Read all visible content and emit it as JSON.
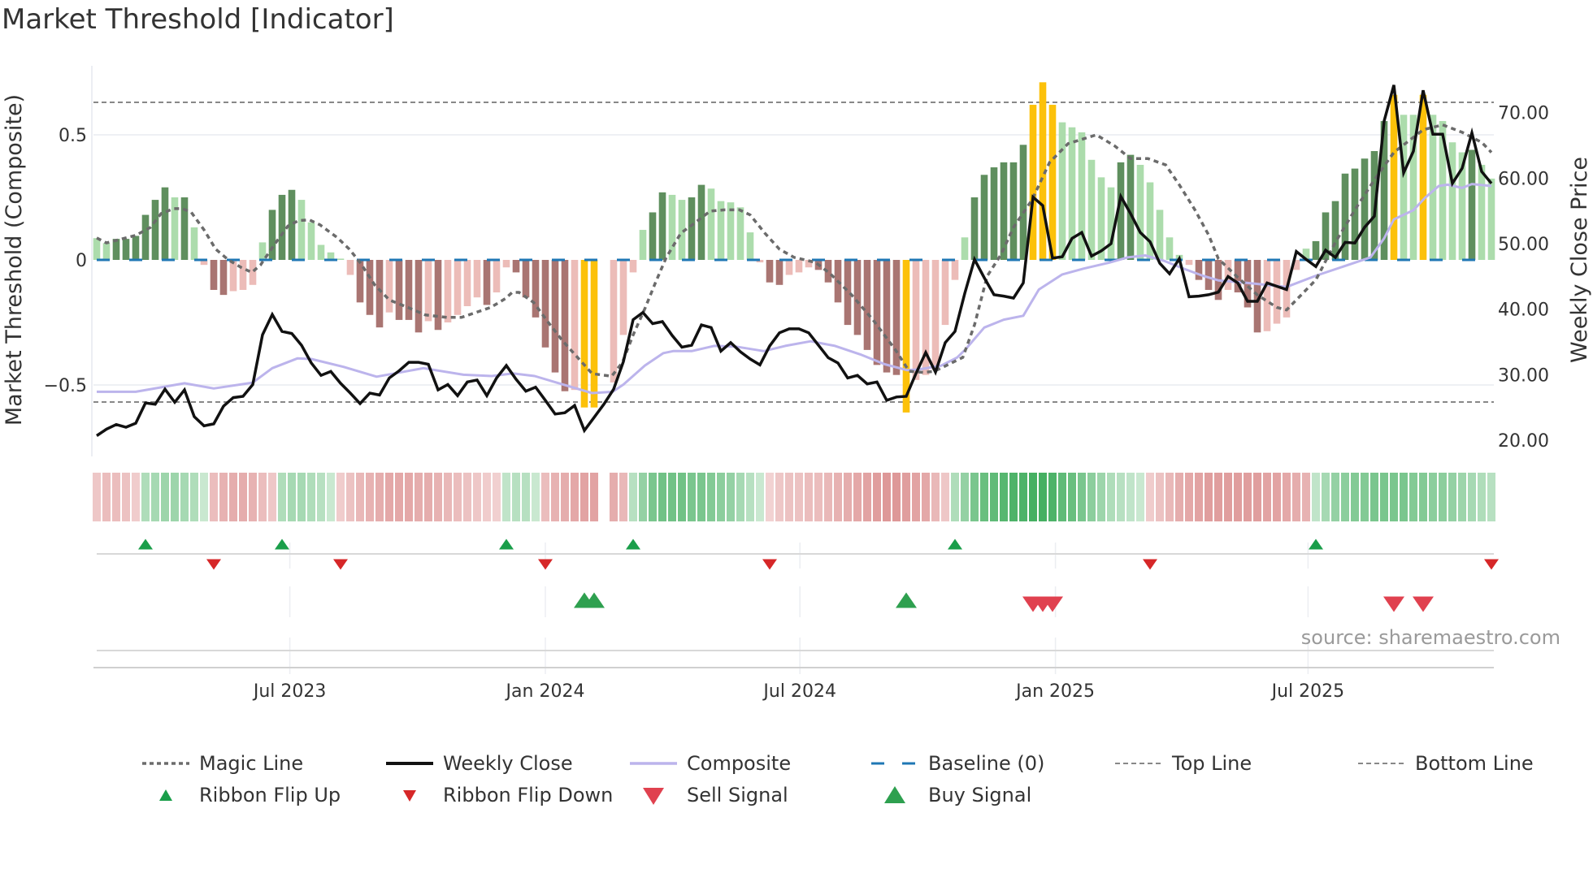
{
  "title": "Market Threshold [Indicator]",
  "source": "source: sharemaestro.com",
  "colors": {
    "hist_dark_green": "#5f8f5e",
    "hist_light_green": "#acdcac",
    "hist_dark_red": "#a97572",
    "hist_light_red": "#ecbcb8",
    "hist_extreme": "#fcc10a",
    "magic": "#6b6b6b",
    "price": "#111111",
    "composite": "#bcb4ec",
    "baseline": "#1f77b4",
    "threshold_lines": "#888888",
    "flip_up": "#1a9e4a",
    "flip_down": "#d62728",
    "sell": "#e0414f",
    "buy": "#2ea04f"
  },
  "chart_data": {
    "type": "bar+line",
    "title": "Market Threshold [Indicator]",
    "x_unit": "week index (weekly bars, ~Feb 2023 to Nov 2025)",
    "xticks": [
      {
        "week": 19.8,
        "label": "Jul 2023"
      },
      {
        "week": 46,
        "label": "Jan 2024"
      },
      {
        "week": 72.1,
        "label": "Jul 2024"
      },
      {
        "week": 98.3,
        "label": "Jan 2025"
      },
      {
        "week": 124.2,
        "label": "Jul 2025"
      }
    ],
    "left_axis": {
      "label": "Market Threshold (Composite)",
      "range": [
        -0.8,
        0.78
      ],
      "ticks": [
        {
          "v": 0.5,
          "label": "0.5"
        },
        {
          "v": 0,
          "label": "0"
        },
        {
          "v": -0.5,
          "label": "−0.5"
        }
      ]
    },
    "right_axis": {
      "label": "Weekly Close Price",
      "range": [
        17,
        77
      ],
      "ticks": [
        {
          "v": 70,
          "label": "70.00"
        },
        {
          "v": 60,
          "label": "60.00"
        },
        {
          "v": 50,
          "label": "50.00"
        },
        {
          "v": 40,
          "label": "40.00"
        },
        {
          "v": 30,
          "label": "30.00"
        },
        {
          "v": 20,
          "label": "20.00"
        }
      ]
    },
    "top_line": 0.63,
    "bottom_line": -0.568,
    "baseline": 0,
    "histogram": {
      "types": "LLDDDDDDLDLLDDLLLLDDDLLLLLLDDDLDDDLDLLLLDLLDDDDDDLYYNLLLLDDLLDDLLLLLLDDLLLDDDDDDDDDYLLLLLLDDDDDDYYYLLLLLLDDLLLLLLDDDLDDDLLLLLDDDDDDDDYLLYLLLLDLL",
      "values": [
        0.087,
        0.067,
        0.084,
        0.084,
        0.096,
        0.18,
        0.24,
        0.29,
        0.25,
        0.25,
        0.13,
        -0.02,
        -0.12,
        -0.14,
        -0.125,
        -0.12,
        -0.1,
        0.07,
        0.2,
        0.26,
        0.28,
        0.24,
        0.15,
        0.06,
        0.03,
        0.005,
        -0.06,
        -0.17,
        -0.22,
        -0.27,
        -0.21,
        -0.24,
        -0.24,
        -0.29,
        -0.245,
        -0.28,
        -0.25,
        -0.22,
        -0.185,
        -0.15,
        -0.18,
        -0.13,
        -0.03,
        -0.05,
        -0.15,
        -0.23,
        -0.35,
        -0.45,
        -0.525,
        -0.52,
        -0.59,
        -0.59,
        0,
        -0.49,
        -0.3,
        -0.05,
        0.12,
        0.19,
        0.27,
        0.26,
        0.24,
        0.25,
        0.3,
        0.285,
        0.235,
        0.23,
        0.21,
        0.11,
        -0.01,
        -0.09,
        -0.1,
        -0.06,
        -0.05,
        -0.03,
        -0.04,
        -0.09,
        -0.17,
        -0.26,
        -0.3,
        -0.36,
        -0.42,
        -0.45,
        -0.46,
        -0.61,
        -0.48,
        -0.46,
        -0.44,
        -0.26,
        -0.08,
        0.09,
        0.25,
        0.34,
        0.37,
        0.39,
        0.39,
        0.46,
        0.62,
        0.71,
        0.62,
        0.55,
        0.53,
        0.51,
        0.4,
        0.33,
        0.29,
        0.39,
        0.42,
        0.38,
        0.31,
        0.2,
        0.09,
        0.02,
        -0.02,
        -0.08,
        -0.12,
        -0.16,
        -0.12,
        -0.13,
        -0.19,
        -0.29,
        -0.285,
        -0.255,
        -0.23,
        -0.04,
        0.045,
        0.075,
        0.19,
        0.235,
        0.345,
        0.365,
        0.405,
        0.435,
        0.555,
        0.66,
        0.58,
        0.58,
        0.66,
        0.58,
        0.555,
        0.47,
        0.43,
        0.44,
        0.38,
        0.325
      ]
    },
    "weekly_close": [
      20.7,
      21.7,
      22.4,
      22,
      22.6,
      25.7,
      25.5,
      27.8,
      25.8,
      27.7,
      23.6,
      22.2,
      22.5,
      25.2,
      26.5,
      26.7,
      28.5,
      36.1,
      39.2,
      36.6,
      36.3,
      34.5,
      31.8,
      29.9,
      30.5,
      28.7,
      27.2,
      25.6,
      27.2,
      26.9,
      29.5,
      30.6,
      31.9,
      31.9,
      31.6,
      27.7,
      28.5,
      26.8,
      28.9,
      29.2,
      26.8,
      29.5,
      31.4,
      29.3,
      27.5,
      28.1,
      26.1,
      24,
      24.2,
      25.3,
      21.5,
      23.5,
      25.5,
      27.8,
      32,
      38.4,
      39.5,
      37.8,
      38.1,
      36,
      34.2,
      34.5,
      37.6,
      37.2,
      33.6,
      34.9,
      33.5,
      32.4,
      31.5,
      34.4,
      36.4,
      37,
      37,
      36.4,
      34.5,
      32.6,
      31.8,
      29.5,
      29.9,
      28.6,
      28.9,
      26.1,
      26.6,
      26.7,
      30.2,
      33.4,
      30.4,
      34.9,
      36.6,
      42.4,
      47.6,
      44.8,
      42.2,
      42,
      41.7,
      44,
      57.1,
      55.8,
      47.8,
      48,
      50.8,
      51.7,
      48.1,
      48.9,
      50,
      57.2,
      54.6,
      51.7,
      50.3,
      47,
      45.4,
      47.7,
      41.9,
      42,
      42.2,
      42.6,
      45,
      44,
      41.2,
      41.2,
      44,
      43.5,
      43,
      48.8,
      47.6,
      46.5,
      49,
      47.9,
      50.2,
      50.1,
      52.5,
      54.2,
      68.7,
      74.2,
      60.8,
      64.1,
      73.4,
      66.7,
      66.7,
      59.2,
      61.5,
      66.9,
      61,
      59.2
    ],
    "composite": [
      [
        0,
        27.4
      ],
      [
        4,
        27.4
      ],
      [
        9,
        28.7
      ],
      [
        12,
        27.9
      ],
      [
        16,
        28.8
      ],
      [
        18,
        31
      ],
      [
        20.6,
        32.5
      ],
      [
        22,
        32.4
      ],
      [
        25.3,
        31.2
      ],
      [
        28.7,
        29.7
      ],
      [
        33.5,
        31
      ],
      [
        37.6,
        30
      ],
      [
        40.5,
        29.8
      ],
      [
        42.7,
        30.2
      ],
      [
        44.9,
        29.8
      ],
      [
        47.6,
        28.6
      ],
      [
        50.8,
        27.2
      ],
      [
        52.9,
        27.4
      ],
      [
        54,
        28.5
      ],
      [
        56.2,
        31.4
      ],
      [
        58.1,
        33.3
      ],
      [
        59.1,
        33.6
      ],
      [
        61,
        33.6
      ],
      [
        63.3,
        34.4
      ],
      [
        65.5,
        34.3
      ],
      [
        68.4,
        33.6
      ],
      [
        70.6,
        34.4
      ],
      [
        73.2,
        35.1
      ],
      [
        75.7,
        34.4
      ],
      [
        78.3,
        33.1
      ],
      [
        80.8,
        31.6
      ],
      [
        83.1,
        30.7
      ],
      [
        84.3,
        30.8
      ],
      [
        86.6,
        31.4
      ],
      [
        88.2,
        32.6
      ],
      [
        89.1,
        33.9
      ],
      [
        91,
        37.2
      ],
      [
        93,
        38.4
      ],
      [
        95,
        39
      ],
      [
        96.6,
        43
      ],
      [
        99,
        45.3
      ],
      [
        101.2,
        46.2
      ],
      [
        103.8,
        47.1
      ],
      [
        105.7,
        47.9
      ],
      [
        107.5,
        48.2
      ],
      [
        109.4,
        47.4
      ],
      [
        111.6,
        46.1
      ],
      [
        113.4,
        45.1
      ],
      [
        115,
        44.4
      ],
      [
        118,
        44
      ],
      [
        122,
        43.4
      ],
      [
        125,
        45.1
      ],
      [
        128,
        46.6
      ],
      [
        130.6,
        47.9
      ],
      [
        132,
        50.8
      ],
      [
        133,
        53.7
      ],
      [
        135,
        55.1
      ],
      [
        136.2,
        57
      ],
      [
        137.6,
        58.8
      ],
      [
        138.5,
        59
      ],
      [
        140,
        58.5
      ],
      [
        141,
        59.1
      ],
      [
        143,
        58.8
      ]
    ],
    "magic_line": [
      [
        0,
        0.088
      ],
      [
        1,
        0.068
      ],
      [
        4,
        0.098
      ],
      [
        5.5,
        0.13
      ],
      [
        6.6,
        0.185
      ],
      [
        7.9,
        0.205
      ],
      [
        8.8,
        0.205
      ],
      [
        9.7,
        0.19
      ],
      [
        11,
        0.12
      ],
      [
        12.2,
        0.043
      ],
      [
        13.5,
        0
      ],
      [
        14.8,
        -0.03
      ],
      [
        15.9,
        -0.05
      ],
      [
        16.8,
        -0.02
      ],
      [
        18.1,
        0.055
      ],
      [
        19.6,
        0.135
      ],
      [
        20.7,
        0.157
      ],
      [
        21.8,
        0.16
      ],
      [
        22.9,
        0.14
      ],
      [
        24.7,
        0.088
      ],
      [
        25.9,
        0.043
      ],
      [
        27,
        -0.01
      ],
      [
        28.5,
        -0.1
      ],
      [
        30,
        -0.16
      ],
      [
        31.9,
        -0.19
      ],
      [
        33.7,
        -0.22
      ],
      [
        35.9,
        -0.23
      ],
      [
        37.4,
        -0.23
      ],
      [
        40.4,
        -0.19
      ],
      [
        41.9,
        -0.155
      ],
      [
        42.6,
        -0.13
      ],
      [
        43.3,
        -0.13
      ],
      [
        44.8,
        -0.17
      ],
      [
        46.3,
        -0.25
      ],
      [
        47.8,
        -0.325
      ],
      [
        49.3,
        -0.39
      ],
      [
        50.8,
        -0.455
      ],
      [
        52.8,
        -0.465
      ],
      [
        53.9,
        -0.41
      ],
      [
        55,
        -0.3
      ],
      [
        56.2,
        -0.195
      ],
      [
        57.3,
        -0.09
      ],
      [
        58.4,
        0.01
      ],
      [
        59.9,
        0.107
      ],
      [
        61.4,
        0.15
      ],
      [
        62.9,
        0.195
      ],
      [
        64.4,
        0.2
      ],
      [
        65.9,
        0.2
      ],
      [
        67,
        0.18
      ],
      [
        68.5,
        0.107
      ],
      [
        70,
        0.043
      ],
      [
        71.5,
        0.01
      ],
      [
        73.7,
        -0.01
      ],
      [
        75.2,
        -0.055
      ],
      [
        77.4,
        -0.14
      ],
      [
        79.6,
        -0.24
      ],
      [
        81.9,
        -0.36
      ],
      [
        83.3,
        -0.445
      ],
      [
        84.8,
        -0.45
      ],
      [
        85.9,
        -0.445
      ],
      [
        88.8,
        -0.39
      ],
      [
        90,
        -0.26
      ],
      [
        91.3,
        -0.065
      ],
      [
        92.7,
        0.02
      ],
      [
        94,
        0.13
      ],
      [
        95.9,
        0.24
      ],
      [
        97.7,
        0.39
      ],
      [
        99.6,
        0.465
      ],
      [
        102.5,
        0.5
      ],
      [
        104.4,
        0.455
      ],
      [
        106,
        0.405
      ],
      [
        107.8,
        0.405
      ],
      [
        109.6,
        0.38
      ],
      [
        111,
        0.3
      ],
      [
        112.6,
        0.2
      ],
      [
        114,
        0.1
      ],
      [
        115,
        0.005
      ],
      [
        117,
        -0.07
      ],
      [
        119,
        -0.14
      ],
      [
        121,
        -0.19
      ],
      [
        122,
        -0.2
      ],
      [
        123,
        -0.16
      ],
      [
        125,
        -0.08
      ],
      [
        127,
        0.07
      ],
      [
        129,
        0.2
      ],
      [
        131,
        0.32
      ],
      [
        133,
        0.43
      ],
      [
        135,
        0.49
      ],
      [
        136,
        0.52
      ],
      [
        138,
        0.54
      ],
      [
        140,
        0.51
      ],
      [
        142,
        0.47
      ],
      [
        143,
        0.43
      ]
    ],
    "ribbon": [
      -0.2,
      -0.3,
      -0.3,
      -0.25,
      -0.15,
      0.3,
      0.35,
      0.4,
      0.4,
      0.35,
      0.3,
      0.15,
      -0.3,
      -0.4,
      -0.45,
      -0.45,
      -0.4,
      -0.3,
      -0.2,
      0.3,
      0.35,
      0.35,
      0.3,
      0.25,
      0.15,
      -0.15,
      -0.25,
      -0.35,
      -0.4,
      -0.45,
      -0.5,
      -0.5,
      -0.5,
      -0.45,
      -0.45,
      -0.4,
      -0.35,
      -0.3,
      -0.25,
      -0.2,
      -0.15,
      -0.12,
      0.2,
      0.25,
      0.25,
      0.15,
      -0.3,
      -0.4,
      -0.45,
      -0.5,
      -0.55,
      -0.55,
      0,
      -0.45,
      -0.35,
      0.25,
      0.45,
      0.6,
      0.65,
      0.65,
      0.65,
      0.6,
      0.6,
      0.55,
      0.5,
      0.45,
      0.35,
      0.25,
      0.15,
      -0.1,
      -0.2,
      -0.25,
      -0.25,
      -0.3,
      -0.3,
      -0.35,
      -0.4,
      -0.45,
      -0.5,
      -0.55,
      -0.6,
      -0.65,
      -0.65,
      -0.6,
      -0.55,
      -0.5,
      -0.35,
      -0.2,
      0.3,
      0.45,
      0.6,
      0.7,
      0.75,
      0.8,
      0.85,
      0.85,
      0.9,
      0.9,
      0.85,
      0.75,
      0.7,
      0.6,
      0.5,
      0.4,
      0.3,
      0.25,
      0.2,
      0.15,
      -0.15,
      -0.25,
      -0.35,
      -0.45,
      -0.5,
      -0.55,
      -0.6,
      -0.6,
      -0.6,
      -0.6,
      -0.6,
      -0.6,
      -0.55,
      -0.55,
      -0.5,
      -0.45,
      -0.4,
      0.2,
      0.35,
      0.45,
      0.5,
      0.55,
      0.55,
      0.6,
      0.6,
      0.6,
      0.6,
      0.55,
      0.55,
      0.5,
      0.5,
      0.45,
      0.4,
      0.35,
      0.3,
      0.25
    ],
    "ribbon_flip_up": [
      5,
      19,
      42,
      55,
      88,
      125
    ],
    "ribbon_flip_down": [
      12,
      25,
      46,
      69,
      108,
      143
    ],
    "buy_signals": [
      50,
      51,
      83
    ],
    "sell_signals": [
      96,
      97,
      98,
      133,
      136
    ],
    "legend_placement": "bottom"
  },
  "legend": {
    "magic": "Magic Line",
    "close": "Weekly Close",
    "composite": "Composite",
    "baseline": "Baseline (0)",
    "top": "Top Line",
    "bottom": "Bottom Line",
    "flip_up": "Ribbon Flip Up",
    "flip_down": "Ribbon Flip Down",
    "sell": "Sell Signal",
    "buy": "Buy Signal"
  }
}
